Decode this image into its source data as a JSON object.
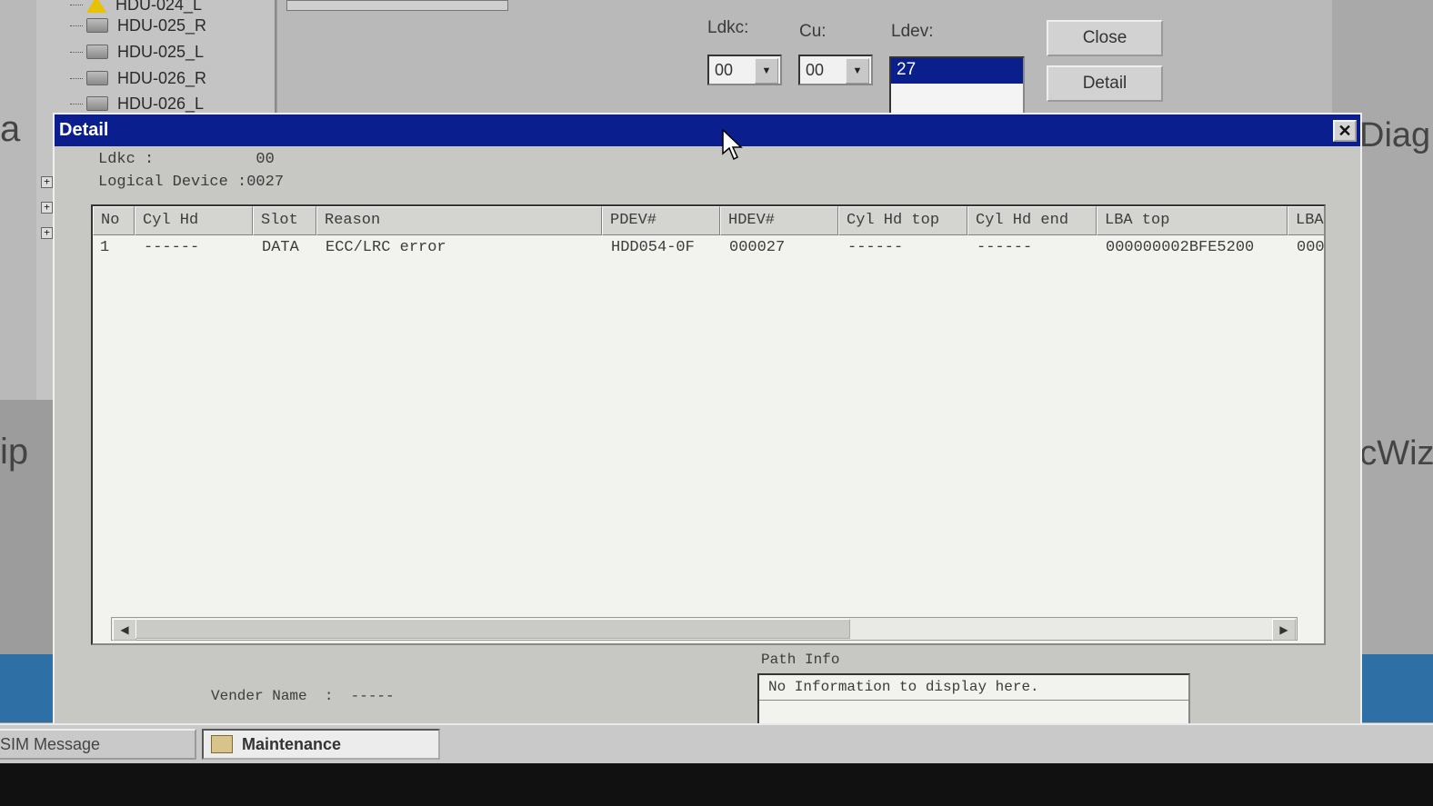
{
  "background": {
    "tree_items": [
      {
        "label": "HDU-024_L",
        "warning": true
      },
      {
        "label": "HDU-025_R",
        "warning": false
      },
      {
        "label": "HDU-025_L",
        "warning": false
      },
      {
        "label": "HDU-026_R",
        "warning": false
      },
      {
        "label": "HDU-026_L",
        "warning": false
      }
    ],
    "edge_left_top": "a",
    "edge_left_mid": "ip",
    "edge_right_top": "Diag",
    "edge_right_mid": "FcWiz",
    "ldkc_label": "Ldkc:",
    "ldkc_value": "00",
    "cu_label": "Cu:",
    "cu_value": "00",
    "ldev_label": "Ldev:",
    "ldev_selected": "27",
    "close_button": "Close",
    "detail_button": "Detail"
  },
  "dialog": {
    "title": "Detail",
    "ldkc_line": "Ldkc :           00",
    "logical_device_line": "Logical Device :0027",
    "columns": [
      "No",
      "Cyl Hd",
      "Slot",
      "Reason",
      "PDEV#",
      "HDEV#",
      "Cyl Hd top",
      "Cyl Hd end",
      "LBA top",
      "LBA"
    ],
    "rows": [
      [
        "1",
        "------",
        "DATA",
        "ECC/LRC error",
        "HDD054-0F",
        "000027",
        "------",
        "------",
        "000000002BFE5200",
        "000"
      ]
    ],
    "vender_line": "Vender Name  :  -----",
    "path_info_label": "Path Info",
    "path_info_text": "No Information to display here."
  },
  "taskbar": {
    "items": [
      {
        "label": "SIM Message",
        "active": false
      },
      {
        "label": "Maintenance",
        "active": true
      }
    ]
  },
  "colors": {
    "titlebar": "#0b1e8d",
    "selection": "#0a1f8c",
    "accent_blue": "#2e6fa6"
  }
}
